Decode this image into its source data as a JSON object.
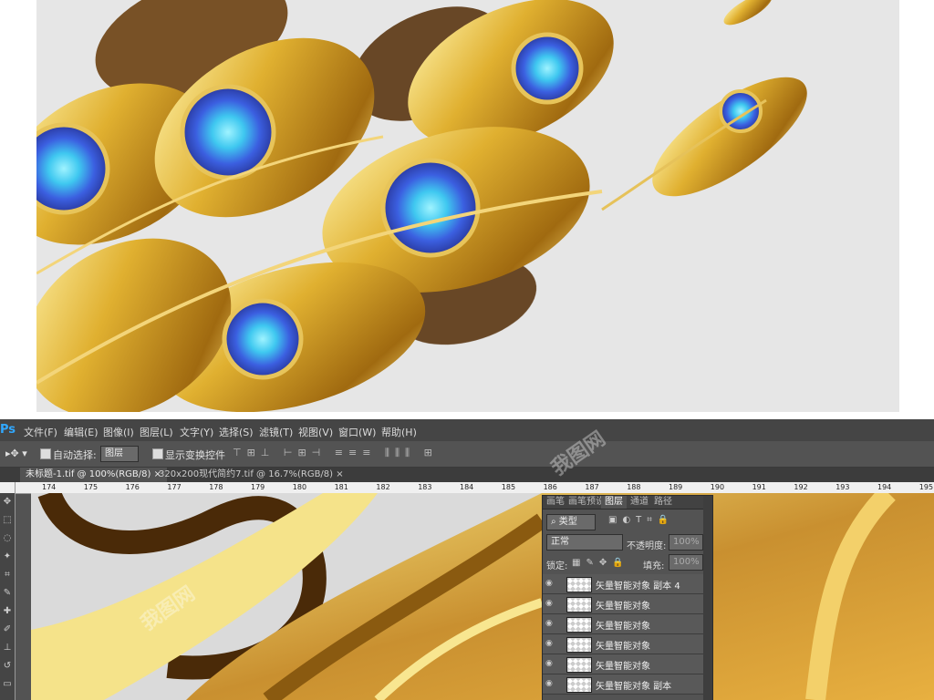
{
  "menubar": {
    "app_logo": "Ps",
    "items": [
      "文件(F)",
      "编辑(E)",
      "图像(I)",
      "图层(L)",
      "文字(Y)",
      "选择(S)",
      "滤镜(T)",
      "视图(V)",
      "窗口(W)",
      "帮助(H)"
    ]
  },
  "options": {
    "auto_select_label": "自动选择:",
    "auto_select_value": "图层",
    "show_transform_label": "显示变换控件"
  },
  "tabs": [
    {
      "label": "未标题-1.tif @ 100%(RGB/8)",
      "close": "×"
    },
    {
      "label": "320x200现代简约7.tif @ 16.7%(RGB/8)",
      "close": "×"
    }
  ],
  "ruler": {
    "ticks": [
      "174",
      "175",
      "176",
      "177",
      "178",
      "179",
      "180",
      "181",
      "182",
      "183",
      "184",
      "185",
      "186",
      "187",
      "188",
      "189",
      "190",
      "191",
      "192",
      "193",
      "194",
      "195"
    ]
  },
  "layers_panel": {
    "tabs": [
      "画笔",
      "画笔预设",
      "图层",
      "通道",
      "路径"
    ],
    "active_tab": "图层",
    "filter_label": "类型",
    "blend_mode": "正常",
    "opacity_label": "不透明度:",
    "opacity_value": "100%",
    "lock_label": "锁定:",
    "fill_label": "填充:",
    "fill_value": "100%",
    "layers": [
      {
        "name": "矢量智能对象 副本 4"
      },
      {
        "name": "矢量智能对象"
      },
      {
        "name": "矢量智能对象"
      },
      {
        "name": "矢量智能对象"
      },
      {
        "name": "矢量智能对象"
      },
      {
        "name": "矢量智能对象 副本"
      }
    ]
  },
  "watermark": "我图网",
  "colors": {
    "accent_blue": "#31a8ff",
    "gold": "#d4a020",
    "peacock_blue": "#3a5fd8"
  }
}
